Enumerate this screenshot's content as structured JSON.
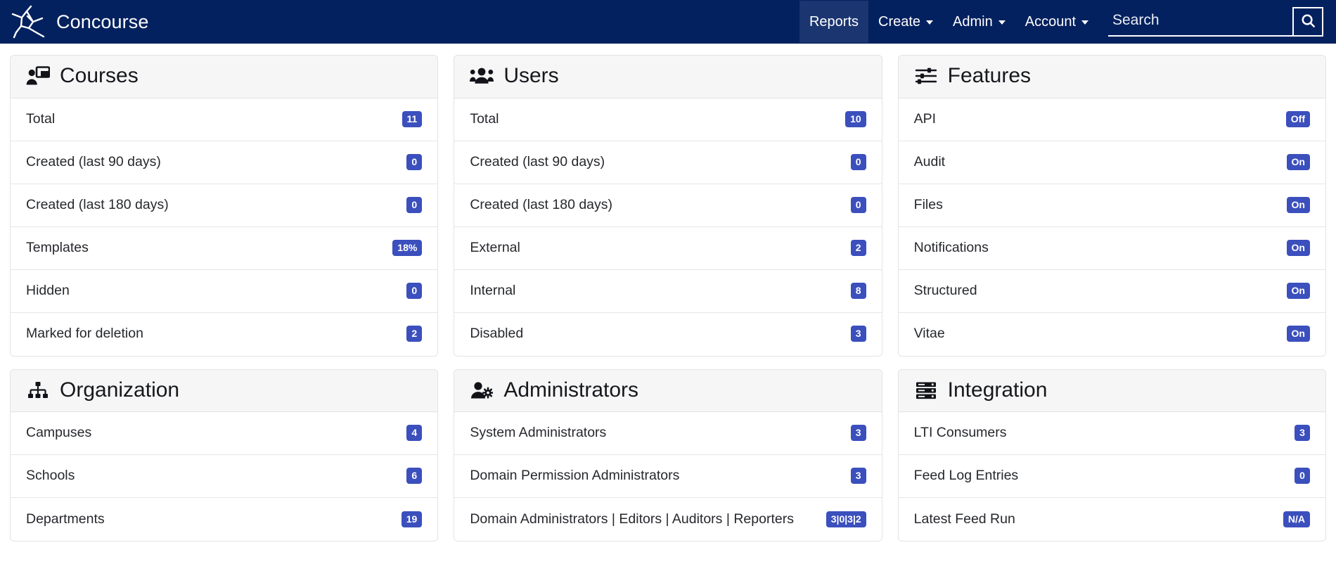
{
  "brand": {
    "name": "Concourse",
    "logo_icon": "star-network-logo-icon"
  },
  "nav": {
    "items": [
      {
        "label": "Reports",
        "has_caret": false,
        "active": true
      },
      {
        "label": "Create",
        "has_caret": true,
        "active": false
      },
      {
        "label": "Admin",
        "has_caret": true,
        "active": false
      },
      {
        "label": "Account",
        "has_caret": true,
        "active": false
      }
    ],
    "search": {
      "placeholder": "Search",
      "value": "",
      "button_icon": "search-icon"
    }
  },
  "theme": {
    "navbar_bg": "#04215f",
    "nav_active_bg": "#1b3570",
    "badge_bg": "#3b4fbd",
    "card_header_bg": "#f6f6f7",
    "card_border": "#e3e3e5",
    "text": "#26282d"
  },
  "cards": [
    {
      "title": "Courses",
      "icon": "chalkboard-user-icon",
      "rows": [
        {
          "label": "Total",
          "badge": "11"
        },
        {
          "label": "Created (last 90 days)",
          "badge": "0"
        },
        {
          "label": "Created (last 180 days)",
          "badge": "0"
        },
        {
          "label": "Templates",
          "badge": "18%"
        },
        {
          "label": "Hidden",
          "badge": "0"
        },
        {
          "label": "Marked for deletion",
          "badge": "2"
        }
      ]
    },
    {
      "title": "Users",
      "icon": "users-group-icon",
      "rows": [
        {
          "label": "Total",
          "badge": "10"
        },
        {
          "label": "Created (last 90 days)",
          "badge": "0"
        },
        {
          "label": "Created (last 180 days)",
          "badge": "0"
        },
        {
          "label": "External",
          "badge": "2"
        },
        {
          "label": "Internal",
          "badge": "8"
        },
        {
          "label": "Disabled",
          "badge": "3"
        }
      ]
    },
    {
      "title": "Features",
      "icon": "sliders-icon",
      "rows": [
        {
          "label": "API",
          "badge": "Off"
        },
        {
          "label": "Audit",
          "badge": "On"
        },
        {
          "label": "Files",
          "badge": "On"
        },
        {
          "label": "Notifications",
          "badge": "On"
        },
        {
          "label": "Structured",
          "badge": "On"
        },
        {
          "label": "Vitae",
          "badge": "On"
        }
      ]
    },
    {
      "title": "Organization",
      "icon": "sitemap-icon",
      "rows": [
        {
          "label": "Campuses",
          "badge": "4"
        },
        {
          "label": "Schools",
          "badge": "6"
        },
        {
          "label": "Departments",
          "badge": "19"
        }
      ]
    },
    {
      "title": "Administrators",
      "icon": "user-gear-icon",
      "rows": [
        {
          "label": "System Administrators",
          "badge": "3"
        },
        {
          "label": "Domain Permission Administrators",
          "badge": "3"
        },
        {
          "label": "Domain Administrators | Editors | Auditors | Reporters",
          "badge": "3|0|3|2"
        }
      ]
    },
    {
      "title": "Integration",
      "icon": "server-icon",
      "rows": [
        {
          "label": "LTI Consumers",
          "badge": "3"
        },
        {
          "label": "Feed Log Entries",
          "badge": "0"
        },
        {
          "label": "Latest Feed Run",
          "badge": "N/A"
        }
      ]
    }
  ]
}
